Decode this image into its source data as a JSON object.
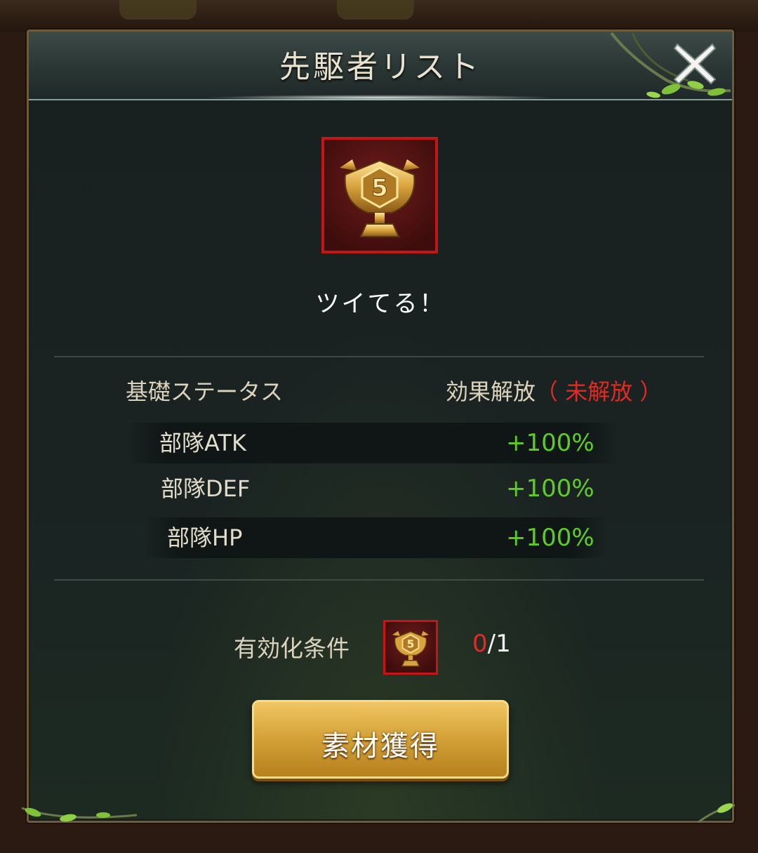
{
  "dialog": {
    "title": "先駆者リスト",
    "close_icon": "close-x-icon"
  },
  "badge": {
    "icon": "trophy-5-icon",
    "name": "ツイてる！"
  },
  "stats": {
    "header_left": "基礎ステータス",
    "header_right": "効果解放",
    "header_status": "（ 未解放 ）",
    "rows": [
      {
        "label": "部隊ATK",
        "value": "+100%"
      },
      {
        "label": "部隊DEF",
        "value": "+100%"
      },
      {
        "label": "部隊HP",
        "value": "+100%"
      }
    ]
  },
  "condition": {
    "label": "有効化条件",
    "icon": "trophy-5-icon",
    "current": "0",
    "required": "/1"
  },
  "action": {
    "button_label": "素材獲得"
  },
  "colors": {
    "accent_red": "#e12a24",
    "value_green": "#5fcc24",
    "button_gold": "#d6a43a"
  }
}
